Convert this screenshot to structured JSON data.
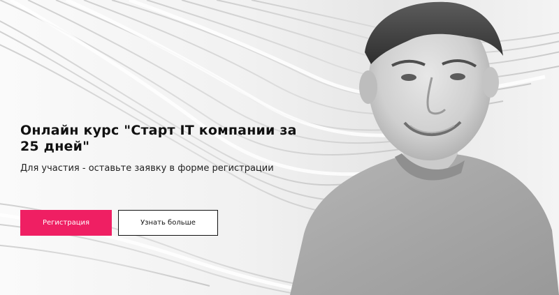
{
  "hero": {
    "title": "Онлайн курс \"Старт IT компании за 25 дней\"",
    "subtitle": "Для участия - оставьте заявку в форме регистрации",
    "register_label": "Регистрация",
    "learn_more_label": "Узнать больше"
  },
  "colors": {
    "accent": "#ef1f63",
    "text": "#111111",
    "background": "#f3f3f3"
  },
  "icons": {
    "background": "abstract-wave-lines",
    "photo": "speaker-portrait"
  }
}
